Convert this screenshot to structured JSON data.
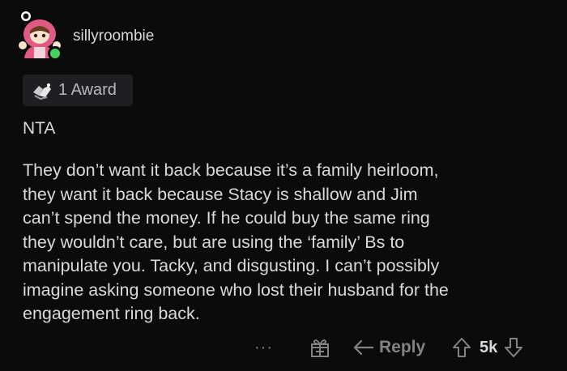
{
  "comment": {
    "username": "sillyroombie",
    "avatar_icon": "snoo-avatar",
    "online_status_color": "#46d160",
    "award": {
      "icon": "hands-award-icon",
      "label": "1 Award"
    },
    "verdict": "NTA",
    "body": "They don’t want it back because it’s a family heirloom,\nthey want it back because Stacy is shallow and Jim\ncan’t spend the money. If he could buy the same ring\nthey wouldn’t care, but are using the ‘family’ Bs to\nmanipulate you. Tacky, and disgusting. I can’t possibly\nimagine asking someone who lost their husband for the\nengagement ring back."
  },
  "actions": {
    "more_label": "···",
    "gift_icon": "gift-icon",
    "reply_label": "Reply",
    "reply_icon": "reply-arrow-icon",
    "score": "5k",
    "upvote_icon": "upvote-arrow-icon",
    "downvote_icon": "downvote-arrow-icon"
  }
}
